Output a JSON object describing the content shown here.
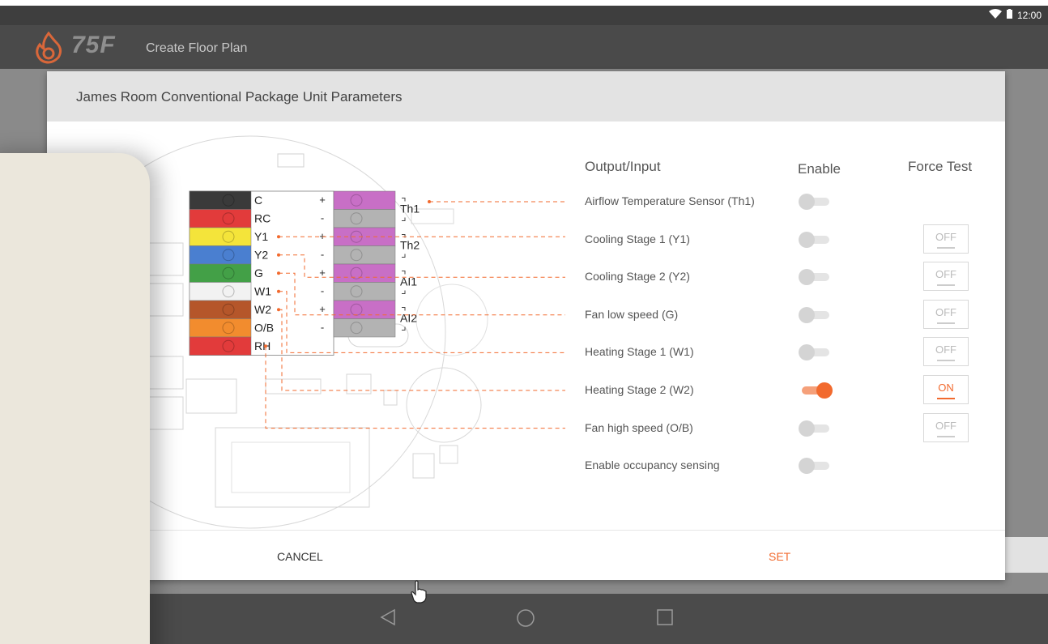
{
  "status_bar": {
    "time": "12:00",
    "wifi_icon": "wifi-icon",
    "battery_icon": "battery-icon"
  },
  "app_bar": {
    "logo_text": "75F",
    "title": "Create Floor Plan"
  },
  "dialog": {
    "title": "James Room Conventional Package Unit Parameters",
    "columns": {
      "output_input": "Output/Input",
      "enable": "Enable",
      "force_test": "Force Test"
    },
    "rows": [
      {
        "label": "Airflow Temperature Sensor (Th1)",
        "enabled": false,
        "force_test": null
      },
      {
        "label": "Cooling Stage 1 (Y1)",
        "enabled": false,
        "force_test": "OFF"
      },
      {
        "label": "Cooling Stage 2 (Y2)",
        "enabled": false,
        "force_test": "OFF"
      },
      {
        "label": "Fan low speed (G)",
        "enabled": false,
        "force_test": "OFF"
      },
      {
        "label": "Heating Stage 1 (W1)",
        "enabled": false,
        "force_test": "OFF"
      },
      {
        "label": "Heating Stage 2 (W2)",
        "enabled": true,
        "force_test": "ON"
      },
      {
        "label": "Fan high speed  (O/B)",
        "enabled": false,
        "force_test": "OFF"
      },
      {
        "label": "Enable occupancy sensing",
        "enabled": false,
        "force_test": null
      }
    ],
    "cancel_label": "CANCEL",
    "set_label": "SET"
  },
  "terminals_left": [
    "C",
    "RC",
    "Y1",
    "Y2",
    "G",
    "W1",
    "W2",
    "O/B",
    "RH"
  ],
  "terminals_left_colors": [
    "#3a3a3a",
    "#e23b3b",
    "#f4e43a",
    "#4a7fd0",
    "#43a047",
    "#f2f2f2",
    "#b5562a",
    "#f28c2e",
    "#e23b3b"
  ],
  "terminals_right": [
    "Th1",
    "Th2",
    "AI1",
    "AI2"
  ],
  "polarity": [
    "+",
    "-",
    "+",
    "-",
    "+",
    "-",
    "+",
    "-"
  ],
  "colors": {
    "accent": "#f26a2e",
    "header_bg": "#e3e3e3",
    "appbar_bg": "#4a4a4a",
    "statusbar_bg": "#3e3e3e"
  },
  "nav_icons": [
    "back-icon",
    "home-icon",
    "recents-icon"
  ]
}
